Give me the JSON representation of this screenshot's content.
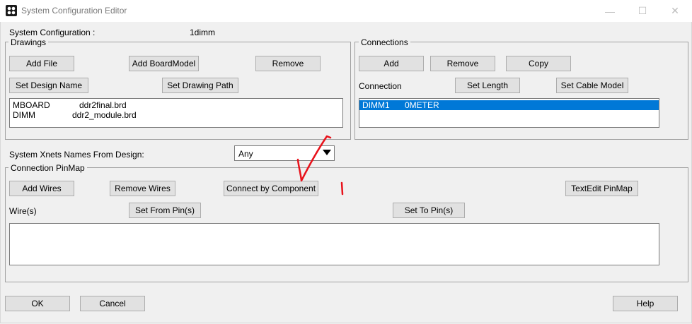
{
  "window": {
    "title": "System Configuration Editor",
    "controls": {
      "minimize": "—",
      "maximize": "☐",
      "close": "✕"
    }
  },
  "system_config": {
    "label": "System Configuration :",
    "value": "1dimm"
  },
  "drawings": {
    "group_label": "Drawings",
    "buttons": {
      "add_file": "Add File",
      "add_board_model": "Add BoardModel",
      "remove": "Remove",
      "set_design_name": "Set Design Name",
      "set_drawing_path": "Set Drawing Path"
    },
    "rows": [
      {
        "name": "MBOARD",
        "file": "ddr2final.brd"
      },
      {
        "name": "DIMM",
        "file": "ddr2_module.brd"
      }
    ]
  },
  "connections": {
    "group_label": "Connections",
    "buttons": {
      "add": "Add",
      "remove": "Remove",
      "copy": "Copy",
      "set_length": "Set Length",
      "set_cable_model": "Set Cable Model"
    },
    "connection_label": "Connection",
    "rows": [
      {
        "name": "DIMM1",
        "length": "0METER",
        "selected": true
      }
    ]
  },
  "xnets": {
    "label": "System Xnets Names From Design:",
    "selected": "Any"
  },
  "pinmap": {
    "group_label": "Connection PinMap",
    "buttons": {
      "add_wires": "Add Wires",
      "remove_wires": "Remove Wires",
      "connect_by_component": "Connect by Component",
      "textedit_pinmap": "TextEdit PinMap",
      "set_from_pins": "Set From Pin(s)",
      "set_to_pins": "Set To Pin(s)"
    },
    "wires_label": "Wire(s)"
  },
  "footer": {
    "ok": "OK",
    "cancel": "Cancel",
    "help": "Help"
  },
  "colors": {
    "selection": "#0078d7",
    "annotation": "#e8121b"
  }
}
